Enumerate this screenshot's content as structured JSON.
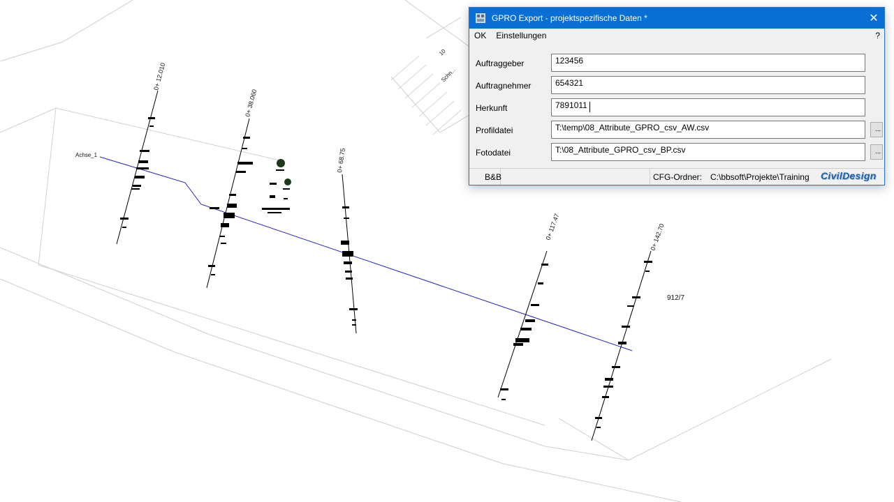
{
  "cad": {
    "axis_label": "Achse_1",
    "parcel_label": "912/7",
    "road_label": "Schn...",
    "road_number": "10",
    "stations": [
      "0+ 12.010",
      "0+ 38.060",
      "0+ 68.75",
      "0+ 117.47",
      "0+ 142.70"
    ]
  },
  "dialog": {
    "title": "GPRO Export - projektspezifische Daten *",
    "close_glyph": "✕",
    "menu": {
      "ok": "OK",
      "settings": "Einstellungen",
      "help": "?"
    },
    "fields": [
      {
        "label": "Auftraggeber",
        "value": "123456"
      },
      {
        "label": "Auftragnehmer",
        "value": "654321"
      },
      {
        "label": "Herkunft",
        "value": "7891011"
      },
      {
        "label": "Profildatei",
        "value": "T:\\temp\\08_Attribute_GPRO_csv_AW.csv",
        "browse": "..."
      },
      {
        "label": "Fotodatei",
        "value": "T:\\08_Attribute_GPRO_csv_BP.csv",
        "browse": "..."
      }
    ],
    "status": {
      "left": "B&B",
      "cfg_label": "CFG-Ordner:",
      "cfg_path": "C:\\bbsoft\\Projekte\\Training",
      "brand": "CivilDesign"
    }
  },
  "colors": {
    "titlebar": "#0a6fd4",
    "axis": "#2020c8",
    "brand": "#1d5fa8"
  }
}
